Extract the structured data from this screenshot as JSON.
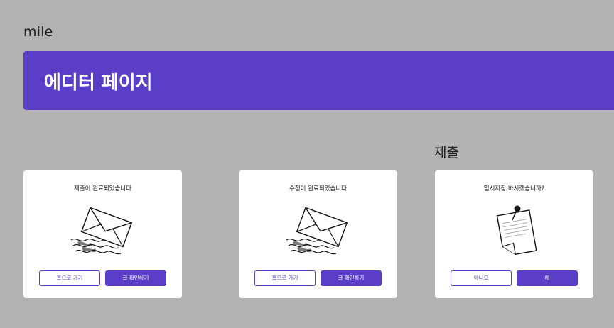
{
  "app": {
    "title": "mile"
  },
  "banner": {
    "title": "에디터 페이지"
  },
  "section": {
    "label": "제출"
  },
  "colors": {
    "accent": "#5a3ec8",
    "background": "#b3b3b3",
    "card": "#ffffff"
  },
  "cards": [
    {
      "title": "제출이 완료되었습니다",
      "icon": "envelope-icon",
      "buttons": {
        "secondary": "홈으로 가기",
        "primary": "글 확인하기"
      }
    },
    {
      "title": "수정이 완료되었습니다",
      "icon": "envelope-icon",
      "buttons": {
        "secondary": "홈으로 가기",
        "primary": "글 확인하기"
      }
    },
    {
      "title": "임시저장 하시겠습니까?",
      "icon": "pinned-note-icon",
      "buttons": {
        "secondary": "아니오",
        "primary": "예"
      }
    }
  ]
}
